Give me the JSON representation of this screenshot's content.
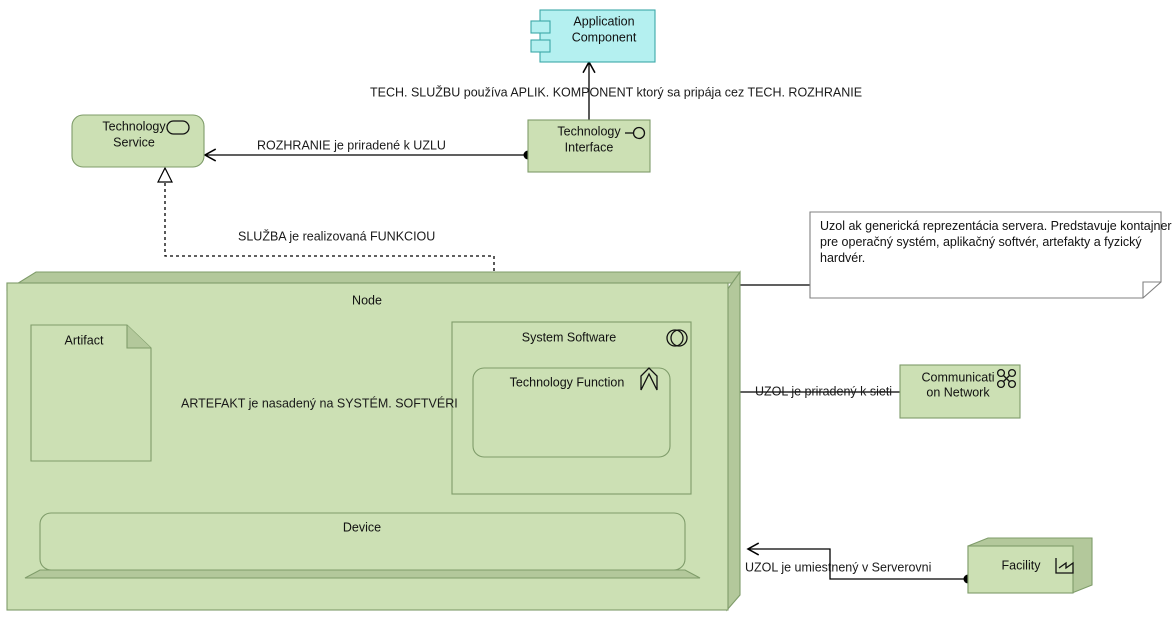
{
  "diagram": {
    "title": "ArchiMate Technology Layer",
    "colors": {
      "technology_fill": "#cce0b4",
      "technology_stroke": "#7f9c6a",
      "node_bevel": "#b3c89b",
      "application_fill": "#b4f0f0",
      "application_stroke": "#3ca8a8",
      "note_fill": "#ffffff",
      "note_stroke": "#808080",
      "line": "#000000",
      "text": "#111111"
    }
  },
  "elements": {
    "application_component": {
      "label_line1": "Application",
      "label_line2": "Component",
      "icon": "application-component-icon"
    },
    "technology_service": {
      "label_line1": "Technology",
      "label_line2": "Service",
      "icon": "rounded-rect-service-icon"
    },
    "technology_interface": {
      "label_line1": "Technology",
      "label_line2": "Interface",
      "icon": "lollipop-interface-icon"
    },
    "node": {
      "label": "Node",
      "icon": "three-d-box-icon"
    },
    "artifact": {
      "label": "Artifact",
      "icon": "document-folded-corner-icon"
    },
    "system_software": {
      "label": "System Software",
      "icon": "double-circle-icon"
    },
    "technology_function": {
      "label": "Technology Function",
      "icon": "arrow-chevron-function-icon"
    },
    "device": {
      "label": "Device",
      "icon": "device-pedestal-icon"
    },
    "communication_network": {
      "label_line1": "Communicati",
      "label_line2": "on Network",
      "icon": "network-nodes-icon"
    },
    "facility": {
      "label": "Facility",
      "icon": "factory-icon"
    },
    "note": {
      "line1": "Uzol ak generická reprezentácia servera. Predstavuje kontajner",
      "line2": "pre operačný systém, aplikačný softvér, artefakty a fyzický",
      "line3": "hardvér."
    }
  },
  "relationships": {
    "service_used_by_component": "TECH. SLUŽBU používa APLIK. KOMPONENT ktorý sa pripája cez TECH. ROZHRANIE",
    "interface_assigned_to_node": "ROZHRANIE je priradené k UZLU",
    "service_realized_by_function": "SLUŽBA je realizovaná FUNKCIOU",
    "artifact_deployed_on_system_software": "ARTEFAKT je nasadený na SYSTÉM. SOFTVÉRI",
    "node_assigned_to_network": "UZOL je priradený k sieti",
    "node_located_in_facility": "UZOL je umiestnený v Serverovni"
  }
}
